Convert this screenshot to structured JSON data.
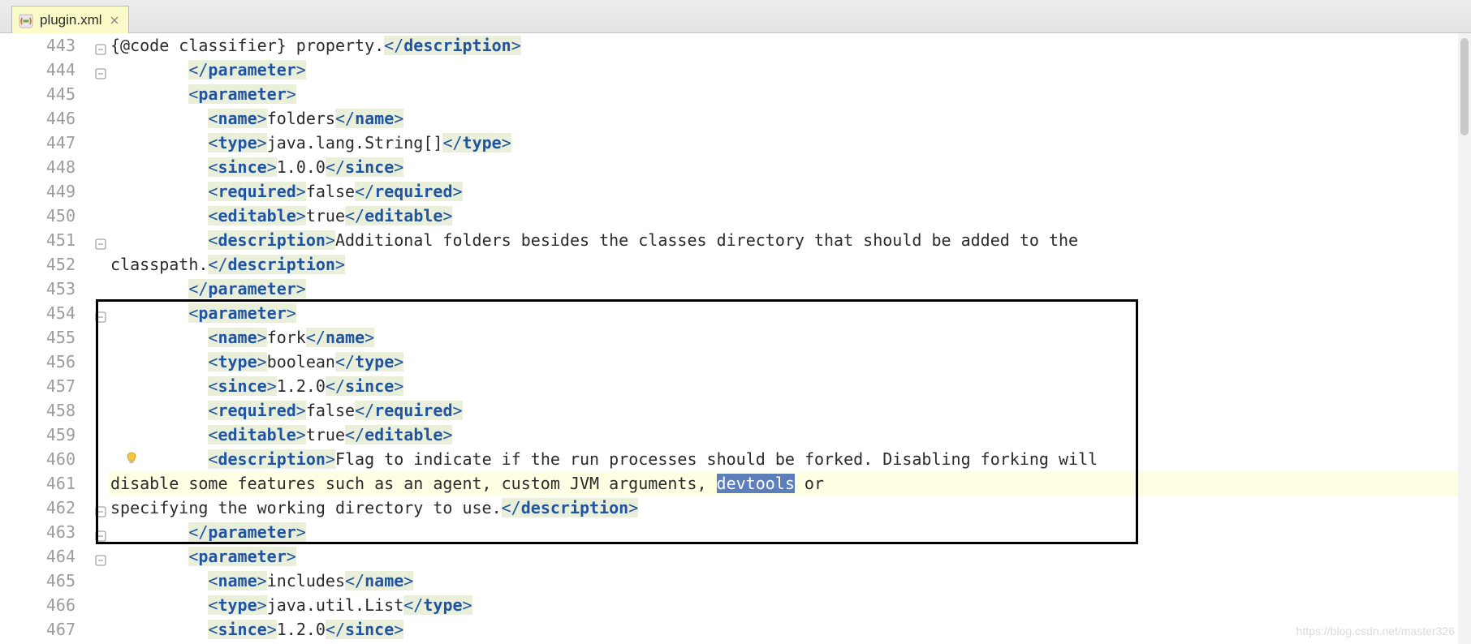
{
  "tab": {
    "filename": "plugin.xml"
  },
  "line_start": 443,
  "selected_word": "devtools",
  "current_line_index": 18,
  "highlight_box": {
    "start_line_index": 11,
    "end_line_index": 20
  },
  "bulb_line_index": 17,
  "fold_markers_at": [
    0,
    1,
    8,
    11,
    19,
    20,
    21
  ],
  "code_lines": [
    {
      "indent": 0,
      "segs": [
        {
          "t": "txt",
          "v": "{@code classifier} property."
        },
        {
          "t": "tag",
          "open": false,
          "name": "description"
        }
      ]
    },
    {
      "indent": 8,
      "segs": [
        {
          "t": "tag",
          "open": false,
          "name": "parameter"
        }
      ]
    },
    {
      "indent": 8,
      "segs": [
        {
          "t": "tag",
          "open": true,
          "name": "parameter"
        }
      ]
    },
    {
      "indent": 10,
      "segs": [
        {
          "t": "tag",
          "open": true,
          "name": "name"
        },
        {
          "t": "txt",
          "v": "folders"
        },
        {
          "t": "tag",
          "open": false,
          "name": "name"
        }
      ]
    },
    {
      "indent": 10,
      "segs": [
        {
          "t": "tag",
          "open": true,
          "name": "type"
        },
        {
          "t": "txt",
          "v": "java.lang.String[]"
        },
        {
          "t": "tag",
          "open": false,
          "name": "type"
        }
      ]
    },
    {
      "indent": 10,
      "segs": [
        {
          "t": "tag",
          "open": true,
          "name": "since"
        },
        {
          "t": "txt",
          "v": "1.0.0"
        },
        {
          "t": "tag",
          "open": false,
          "name": "since"
        }
      ]
    },
    {
      "indent": 10,
      "segs": [
        {
          "t": "tag",
          "open": true,
          "name": "required"
        },
        {
          "t": "txt",
          "v": "false"
        },
        {
          "t": "tag",
          "open": false,
          "name": "required"
        }
      ]
    },
    {
      "indent": 10,
      "segs": [
        {
          "t": "tag",
          "open": true,
          "name": "editable"
        },
        {
          "t": "txt",
          "v": "true"
        },
        {
          "t": "tag",
          "open": false,
          "name": "editable"
        }
      ]
    },
    {
      "indent": 10,
      "segs": [
        {
          "t": "tag",
          "open": true,
          "name": "description"
        },
        {
          "t": "txt",
          "v": "Additional folders besides the classes directory that should be added to the"
        }
      ]
    },
    {
      "indent": 0,
      "segs": [
        {
          "t": "txt",
          "v": "classpath."
        },
        {
          "t": "tag",
          "open": false,
          "name": "description"
        }
      ]
    },
    {
      "indent": 8,
      "segs": [
        {
          "t": "tag",
          "open": false,
          "name": "parameter"
        }
      ]
    },
    {
      "indent": 8,
      "segs": [
        {
          "t": "tag",
          "open": true,
          "name": "parameter"
        }
      ]
    },
    {
      "indent": 10,
      "segs": [
        {
          "t": "tag",
          "open": true,
          "name": "name"
        },
        {
          "t": "txt",
          "v": "fork"
        },
        {
          "t": "tag",
          "open": false,
          "name": "name"
        }
      ]
    },
    {
      "indent": 10,
      "segs": [
        {
          "t": "tag",
          "open": true,
          "name": "type"
        },
        {
          "t": "txt",
          "v": "boolean"
        },
        {
          "t": "tag",
          "open": false,
          "name": "type"
        }
      ]
    },
    {
      "indent": 10,
      "segs": [
        {
          "t": "tag",
          "open": true,
          "name": "since"
        },
        {
          "t": "txt",
          "v": "1.2.0"
        },
        {
          "t": "tag",
          "open": false,
          "name": "since"
        }
      ]
    },
    {
      "indent": 10,
      "segs": [
        {
          "t": "tag",
          "open": true,
          "name": "required"
        },
        {
          "t": "txt",
          "v": "false"
        },
        {
          "t": "tag",
          "open": false,
          "name": "required"
        }
      ]
    },
    {
      "indent": 10,
      "segs": [
        {
          "t": "tag",
          "open": true,
          "name": "editable"
        },
        {
          "t": "txt",
          "v": "true"
        },
        {
          "t": "tag",
          "open": false,
          "name": "editable"
        }
      ]
    },
    {
      "indent": 10,
      "segs": [
        {
          "t": "tag",
          "open": true,
          "name": "description"
        },
        {
          "t": "txt",
          "v": "Flag to indicate if the run processes should be forked. Disabling forking will"
        }
      ]
    },
    {
      "indent": 0,
      "segs": [
        {
          "t": "txt",
          "v": "disable some features such as an agent, custom JVM arguments, "
        },
        {
          "t": "sel",
          "v": "devtools"
        },
        {
          "t": "txt",
          "v": " or"
        }
      ]
    },
    {
      "indent": 0,
      "segs": [
        {
          "t": "txt",
          "v": "specifying the working directory to use."
        },
        {
          "t": "tag",
          "open": false,
          "name": "description"
        }
      ]
    },
    {
      "indent": 8,
      "segs": [
        {
          "t": "tag",
          "open": false,
          "name": "parameter"
        }
      ]
    },
    {
      "indent": 8,
      "segs": [
        {
          "t": "tag",
          "open": true,
          "name": "parameter"
        }
      ]
    },
    {
      "indent": 10,
      "segs": [
        {
          "t": "tag",
          "open": true,
          "name": "name"
        },
        {
          "t": "txt",
          "v": "includes"
        },
        {
          "t": "tag",
          "open": false,
          "name": "name"
        }
      ]
    },
    {
      "indent": 10,
      "segs": [
        {
          "t": "tag",
          "open": true,
          "name": "type"
        },
        {
          "t": "txt",
          "v": "java.util.List"
        },
        {
          "t": "tag",
          "open": false,
          "name": "type"
        }
      ]
    },
    {
      "indent": 10,
      "segs": [
        {
          "t": "tag",
          "open": true,
          "name": "since"
        },
        {
          "t": "txt",
          "v": "1.2.0"
        },
        {
          "t": "tag",
          "open": false,
          "name": "since"
        }
      ]
    }
  ],
  "watermark": "https://blog.csdn.net/master326"
}
